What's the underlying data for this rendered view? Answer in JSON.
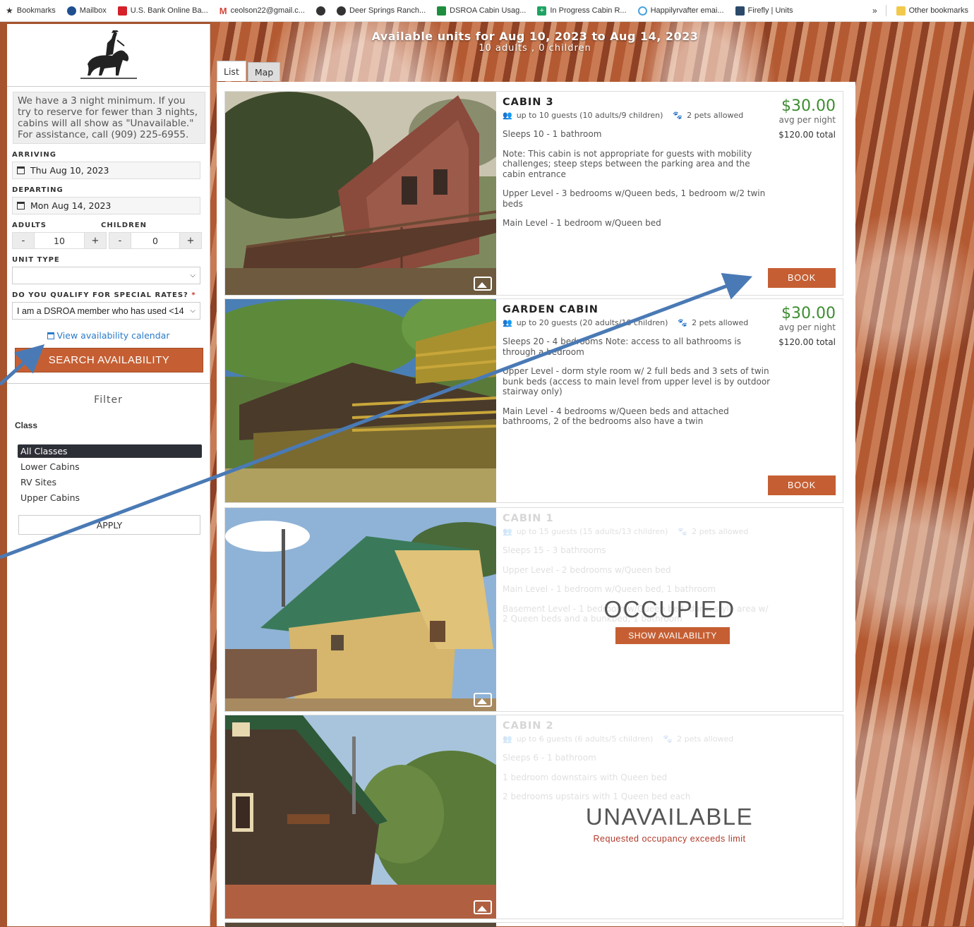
{
  "bookmarks": [
    {
      "label": "Bookmarks",
      "icon": "star-icon",
      "color": "#222222"
    },
    {
      "label": "Mailbox",
      "icon": "mailbox-icon",
      "color": "#1f4f8f"
    },
    {
      "label": "U.S. Bank Online Ba...",
      "icon": "bank-icon",
      "color": "#d4212a"
    },
    {
      "label": "ceolson22@gmail.c...",
      "icon": "gmail-icon",
      "color": "#d44638"
    },
    {
      "label": "",
      "icon": "globe-icon",
      "color": "#333333"
    },
    {
      "label": "Deer Springs Ranch...",
      "icon": "globe-icon",
      "color": "#333333"
    },
    {
      "label": "DSROA Cabin Usag...",
      "icon": "sheets-icon",
      "color": "#1e8e3e"
    },
    {
      "label": "In Progress Cabin R...",
      "icon": "plus-icon",
      "color": "#1ea362"
    },
    {
      "label": "Happilyrvafter emai...",
      "icon": "swirl-icon",
      "color": "#4aa3df"
    },
    {
      "label": "Firefly | Units",
      "icon": "firefly-icon",
      "color": "#2b4a6a"
    }
  ],
  "bookmarks_more": "»",
  "other_bookmarks": "Other bookmarks",
  "sidebar": {
    "notice": "We have a 3 night minimum.  If you try to reserve for fewer than 3 nights, cabins will all show as \"Unavailable.\" For assistance, call (909) 225-6955.",
    "arriving_label": "ARRIVING",
    "arriving_value": "Thu Aug 10, 2023",
    "departing_label": "DEPARTING",
    "departing_value": "Mon Aug 14, 2023",
    "adults_label": "ADULTS",
    "children_label": "CHILDREN",
    "adults_value": "10",
    "children_value": "0",
    "minus": "-",
    "plus": "+",
    "unit_type_label": "UNIT TYPE",
    "unit_type_value": "",
    "special_rates_label": "DO YOU QUALIFY FOR SPECIAL RATES?",
    "required_mark": "*",
    "special_rates_value": "I am a DSROA member who has used <14",
    "calendar_link": "View availability calendar",
    "search_button": "SEARCH AVAILABILITY",
    "filter_title": "Filter",
    "class_title": "Class",
    "classes": [
      "All Classes",
      "Lower Cabins",
      "RV Sites",
      "Upper Cabins"
    ],
    "apply_button": "APPLY"
  },
  "header": {
    "title": "Available units for Aug 10, 2023 to Aug 14, 2023",
    "subtitle": "10 adults , 0 children"
  },
  "tabs": [
    "List",
    "Map"
  ],
  "units": [
    {
      "name": "CABIN 3",
      "guests": "up to 10 guests (10 adults/9 children)",
      "pets": "2 pets allowed",
      "lines": [
        "Sleeps 10 - 1 bathroom",
        "Note: This cabin is not appropriate for guests with mobility challenges; steep steps between the parking area and the cabin entrance",
        "Upper Level - 3 bedrooms w/Queen beds, 1 bedroom w/2 twin beds",
        "Main Level - 1 bedroom w/Queen bed"
      ],
      "price": "$30.00",
      "per_night": "avg per night",
      "total": "$120.00 total",
      "book": "BOOK"
    },
    {
      "name": "GARDEN CABIN",
      "guests": "up to 20 guests (20 adults/18 children)",
      "pets": "2 pets allowed",
      "lines": [
        "Sleeps 20 - 4 bedrooms Note: access to all bathrooms is through a bedroom",
        "Upper Level - dorm style room w/ 2 full beds and 3 sets of twin bunk beds (access to main level from upper level is by outdoor stairway only)",
        "Main Level - 4 bedrooms w/Queen beds and attached bathrooms, 2 of the bedrooms also have a twin"
      ],
      "price": "$30.00",
      "per_night": "avg per night",
      "total": "$120.00 total",
      "book": "BOOK"
    },
    {
      "name": "CABIN 1",
      "guests": "up to 15 guests (15 adults/13 children)",
      "pets": "2 pets allowed",
      "lines": [
        "Sleeps 15 - 3 bathrooms",
        "Upper Level - 2 bedrooms w/Queen bed",
        "Main Level - 1 bedroom w/Queen bed, 1 bathroom",
        "Basement Level - 1 bedroom w/Queen bed, dorm style area w/ 2 Queen beds and a bunkbed, 1 bathroom"
      ],
      "status": "OCCUPIED",
      "status_button": "SHOW AVAILABILITY"
    },
    {
      "name": "CABIN 2",
      "guests": "up to 6 guests (6 adults/5 children)",
      "pets": "2 pets allowed",
      "lines": [
        "Sleeps 6 - 1 bathroom",
        "1 bedroom downstairs with Queen bed",
        "2 bedrooms upstairs with 1 Queen bed each"
      ],
      "status": "UNAVAILABLE",
      "status_sub": "Requested occupancy exceeds limit"
    }
  ],
  "colors": {
    "accent": "#c55f33",
    "price_green": "#3c8d2f",
    "arrow_blue": "#4a7ab5",
    "link_blue": "#2a7bc8"
  }
}
